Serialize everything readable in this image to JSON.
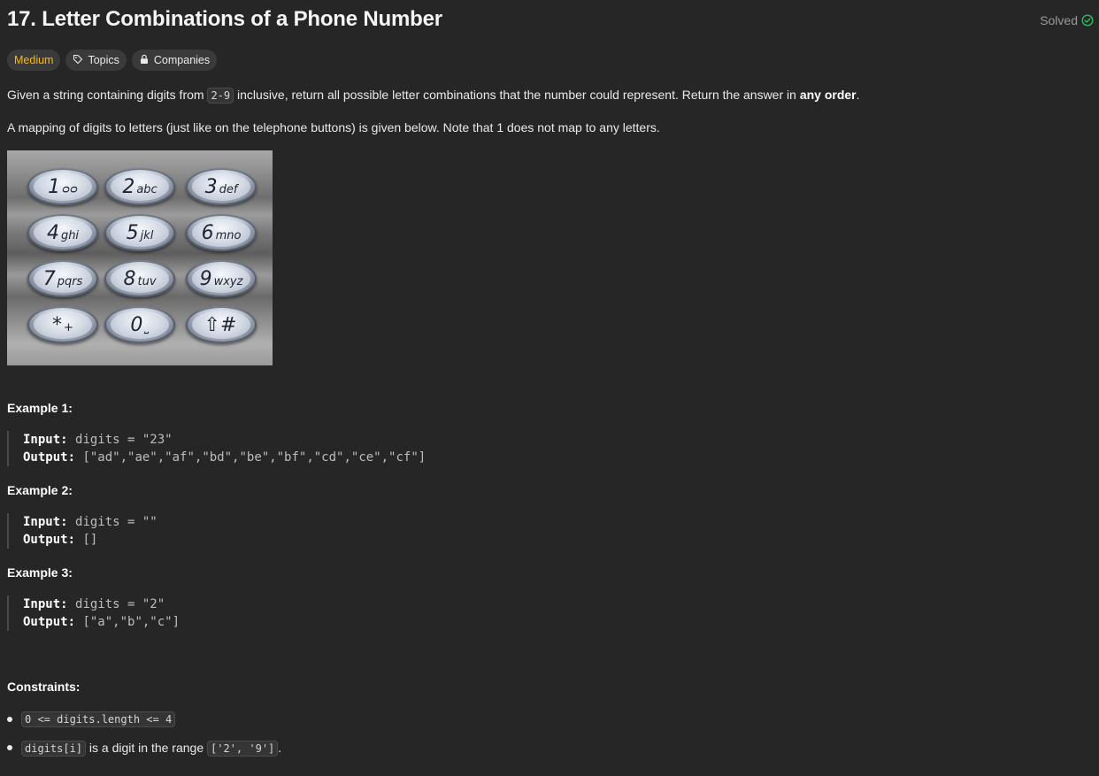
{
  "problem": {
    "title": "17. Letter Combinations of a Phone Number",
    "status": "Solved",
    "difficulty": "Medium",
    "topics_label": "Topics",
    "companies_label": "Companies"
  },
  "description": {
    "p1_before": "Given a string containing digits from ",
    "p1_code": "2-9",
    "p1_after": " inclusive, return all possible letter combinations that the number could represent. Return the answer in ",
    "p1_bold": "any order",
    "p1_end": ".",
    "p2": "A mapping of digits to letters (just like on the telephone buttons) is given below. Note that 1 does not map to any letters."
  },
  "keypad": [
    {
      "digit": "1",
      "letters": "ᴑᴑ"
    },
    {
      "digit": "2",
      "letters": "abc"
    },
    {
      "digit": "3",
      "letters": "def"
    },
    {
      "digit": "4",
      "letters": "ghi"
    },
    {
      "digit": "5",
      "letters": "jkl"
    },
    {
      "digit": "6",
      "letters": "mno"
    },
    {
      "digit": "7",
      "letters": "pqrs"
    },
    {
      "digit": "8",
      "letters": "tuv"
    },
    {
      "digit": "9",
      "letters": "wxyz"
    },
    {
      "digit": "*",
      "letters": "+"
    },
    {
      "digit": "0",
      "letters": "⎵"
    },
    {
      "digit": "⇧#",
      "letters": ""
    }
  ],
  "examples": [
    {
      "heading": "Example 1:",
      "input_label": "Input:",
      "input": "digits = \"23\"",
      "output_label": "Output:",
      "output": "[\"ad\",\"ae\",\"af\",\"bd\",\"be\",\"bf\",\"cd\",\"ce\",\"cf\"]"
    },
    {
      "heading": "Example 2:",
      "input_label": "Input:",
      "input": "digits = \"\"",
      "output_label": "Output:",
      "output": "[]"
    },
    {
      "heading": "Example 3:",
      "input_label": "Input:",
      "input": "digits = \"2\"",
      "output_label": "Output:",
      "output": "[\"a\",\"b\",\"c\"]"
    }
  ],
  "constraints": {
    "heading": "Constraints:",
    "c1_code": "0 <= digits.length <= 4",
    "c2_code1": "digits[i]",
    "c2_text": " is a digit in the range ",
    "c2_code2": "['2', '9']",
    "c2_end": "."
  },
  "colors": {
    "background": "#262626",
    "medium": "#ffb800",
    "solved_check": "#2cbb5d"
  }
}
